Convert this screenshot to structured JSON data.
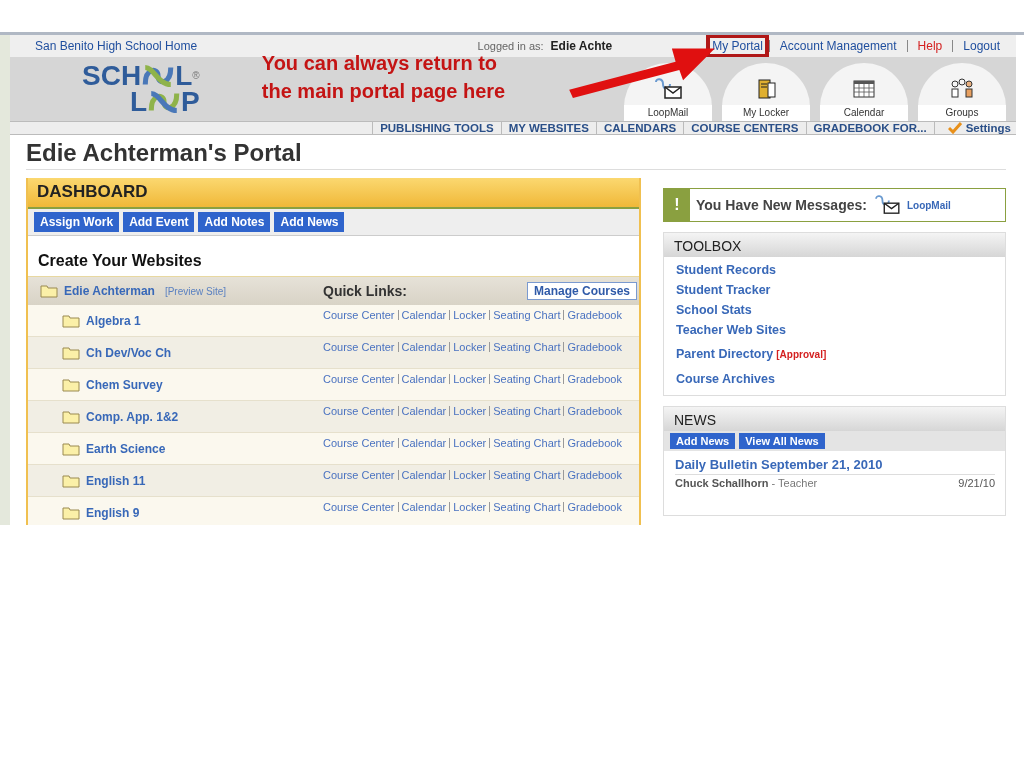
{
  "top_bar": {
    "home_link": "San Benito High School Home",
    "logged_in_label": "Logged in as:",
    "user_name": "Edie Achte",
    "links": [
      {
        "label": "My Portal",
        "color": "#1f4e9e",
        "highlighted": true
      },
      {
        "label": "Account Management",
        "color": "#1f4e9e",
        "highlighted": false
      },
      {
        "label": "Help",
        "color": "#d42020",
        "highlighted": false
      },
      {
        "label": "Logout",
        "color": "#1f4e9e",
        "highlighted": false
      }
    ]
  },
  "logo": {
    "top_left": "SCH",
    "top_right": "L",
    "bottom_left": "L",
    "bottom_right": "P",
    "mark": "®"
  },
  "annotation": {
    "lines": [
      "You can always return to",
      "the main portal page here"
    ]
  },
  "quick_icons": [
    {
      "label": "LoopMail",
      "kind": "mail"
    },
    {
      "label": "My Locker",
      "kind": "locker"
    },
    {
      "label": "Calendar",
      "kind": "calendar"
    },
    {
      "label": "Groups",
      "kind": "groups"
    }
  ],
  "nav_tabs": [
    "PUBLISHING TOOLS",
    "MY WEBSITES",
    "CALENDARS",
    "COURSE CENTERS",
    "GRADEBOOK FOR..."
  ],
  "settings": "Settings",
  "page_title": "Edie Achterman's Portal",
  "dashboard": {
    "title": "DASHBOARD",
    "buttons": [
      "Assign Work",
      "Add Event",
      "Add Notes",
      "Add News"
    ],
    "heading": "Create Your Websites",
    "root": {
      "name": "Edie Achterman",
      "preview": "[Preview Site]"
    },
    "quick_links_label": "Quick Links:",
    "manage_button": "Manage Courses",
    "courses": [
      {
        "name": "Algebra 1",
        "links": [
          "Course Center",
          "Calendar",
          "Locker",
          "Seating Chart",
          "Gradebook"
        ]
      },
      {
        "name": "Ch Dev/Voc Ch",
        "links": [
          "Course Center",
          "Calendar",
          "Locker",
          "Seating Chart",
          "Gradebook"
        ]
      },
      {
        "name": "Chem Survey",
        "links": [
          "Course Center",
          "Calendar",
          "Locker",
          "Seating Chart",
          "Gradebook"
        ]
      },
      {
        "name": "Comp. App. 1&2",
        "links": [
          "Course Center",
          "Calendar",
          "Locker",
          "Seating Chart",
          "Gradebook"
        ]
      },
      {
        "name": "Earth Science",
        "links": [
          "Course Center",
          "Calendar",
          "Locker",
          "Seating Chart",
          "Gradebook"
        ]
      },
      {
        "name": "English 11",
        "links": [
          "Course Center",
          "Calendar",
          "Locker",
          "Seating Chart",
          "Gradebook"
        ]
      },
      {
        "name": "English 9",
        "links": [
          "Course Center",
          "Calendar",
          "Locker",
          "Seating Chart",
          "Gradebook"
        ]
      }
    ]
  },
  "messages": {
    "symbol": "!",
    "text": "You Have New Messages:",
    "link": "LoopMail"
  },
  "toolbox": {
    "title": "TOOLBOX",
    "items": [
      {
        "label": "Student Records"
      },
      {
        "label": "Student Tracker"
      },
      {
        "label": "School Stats"
      },
      {
        "label": "Teacher Web Sites"
      },
      {
        "label": "Parent Directory",
        "badge": "[Approval]"
      },
      {
        "label": "Course Archives"
      }
    ]
  },
  "news": {
    "title": "NEWS",
    "buttons": [
      "Add News",
      "View All News"
    ],
    "items": [
      {
        "title": "Daily Bulletin September 21, 2010",
        "author": "Chuck Schallhorn",
        "role": "- Teacher",
        "date": "9/21/10"
      }
    ]
  }
}
